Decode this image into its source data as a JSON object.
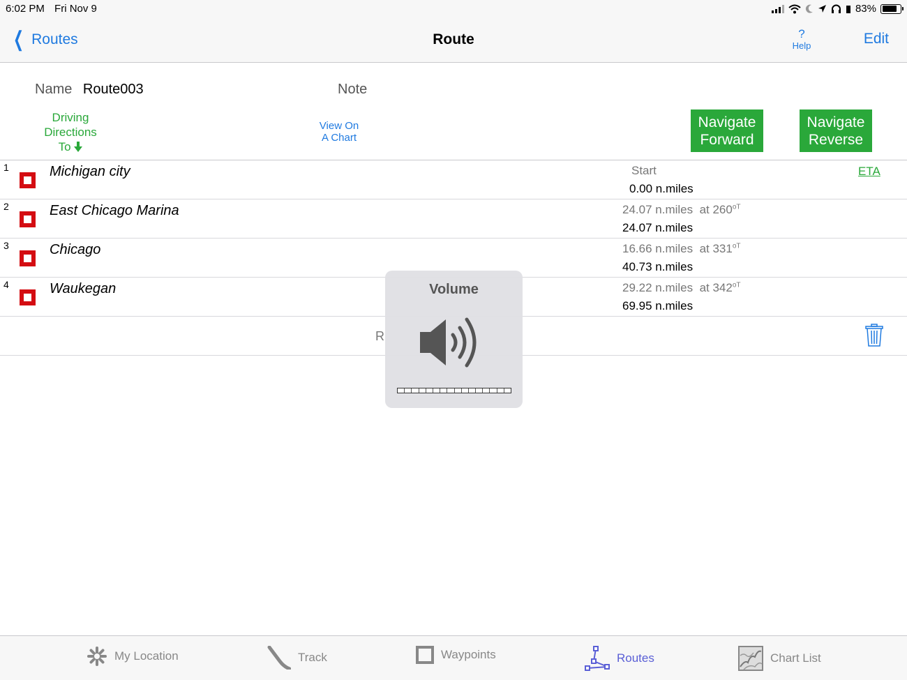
{
  "status_bar": {
    "time": "6:02 PM",
    "date": "Fri Nov 9",
    "battery": "83%",
    "battery_level": 0.83
  },
  "nav": {
    "back_label": "Routes",
    "title": "Route",
    "help_symbol": "?",
    "help_label": "Help",
    "edit_label": "Edit"
  },
  "header": {
    "name_label": "Name",
    "name_value": "Route003",
    "note_label": "Note",
    "driving_line1": "Driving",
    "driving_line2": "Directions",
    "driving_line3": "To",
    "view_chart_line1": "View On",
    "view_chart_line2": "A Chart",
    "navigate_forward_line1": "Navigate",
    "navigate_forward_line2": "Forward",
    "navigate_reverse_line1": "Navigate",
    "navigate_reverse_line2": "Reverse",
    "eta_label": "ETA"
  },
  "route_points": [
    {
      "index": "1",
      "name": "Michigan city",
      "leg": "Start",
      "total": "0.00 n.miles"
    },
    {
      "index": "2",
      "name": "East Chicago Marina",
      "leg_distance": "24.07 n.miles",
      "leg_bearing": "at 260",
      "bearing_unit": "oT",
      "total": "24.07 n.miles"
    },
    {
      "index": "3",
      "name": "Chicago",
      "leg_distance": "16.66 n.miles",
      "leg_bearing": "at 331",
      "bearing_unit": "oT",
      "total": "40.73 n.miles"
    },
    {
      "index": "4",
      "name": "Waukegan",
      "leg_distance": "29.22 n.miles",
      "leg_bearing": "at 342",
      "bearing_unit": "oT",
      "total": "69.95 n.miles"
    }
  ],
  "footer": {
    "partial_text": "R"
  },
  "volume_hud": {
    "title": "Volume",
    "level": 0
  },
  "tabs": [
    {
      "label": "My Location",
      "icon": "asterisk-icon"
    },
    {
      "label": "Track",
      "icon": "track-icon"
    },
    {
      "label": "Waypoints",
      "icon": "waypoint-square-icon"
    },
    {
      "label": "Routes",
      "icon": "route-icon",
      "active": true
    },
    {
      "label": "Chart List",
      "icon": "chart-map-icon"
    }
  ],
  "colors": {
    "accent_blue": "#1f7ae0",
    "green": "#2aa83a",
    "marker_red": "#d40d12",
    "active_tab": "#5a5fd6"
  }
}
